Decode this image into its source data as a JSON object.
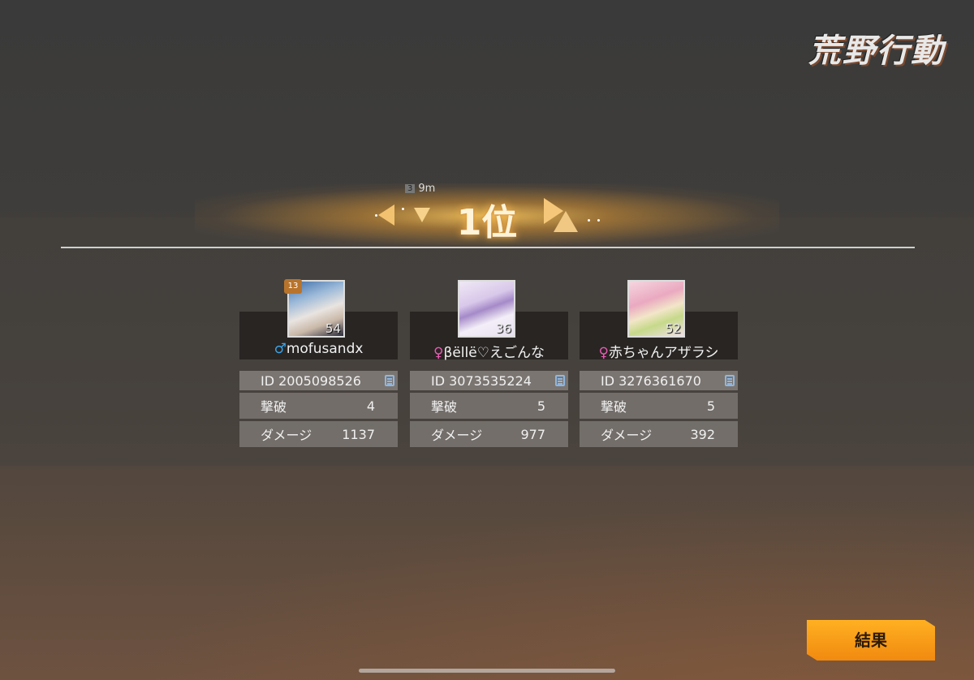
{
  "logo": {
    "text": "荒野行動"
  },
  "match": {
    "rank": "1位",
    "timer": "9m",
    "timer_badge": "3"
  },
  "players": [
    {
      "name": "mofusandx",
      "gender": "♂",
      "level": "54",
      "rank_badge": "13",
      "id": "ID 2005098526",
      "kills_label": "撃破",
      "kills": "4",
      "damage_label": "ダメージ",
      "damage": "1137"
    },
    {
      "name": "βëllë♡えごんな",
      "gender": "♀",
      "level": "36",
      "id": "ID 3073535224",
      "kills_label": "撃破",
      "kills": "5",
      "damage_label": "ダメージ",
      "damage": "977"
    },
    {
      "name": "赤ちゃんアザラシ",
      "gender": "♀",
      "level": "52",
      "id": "ID 3276361670",
      "kills_label": "撃破",
      "kills": "5",
      "damage_label": "ダメージ",
      "damage": "392"
    }
  ],
  "result_button": {
    "label": "結果"
  },
  "colors": {
    "accent": "#f18a10",
    "male": "#3aa3e6",
    "female": "#e85ab3"
  }
}
